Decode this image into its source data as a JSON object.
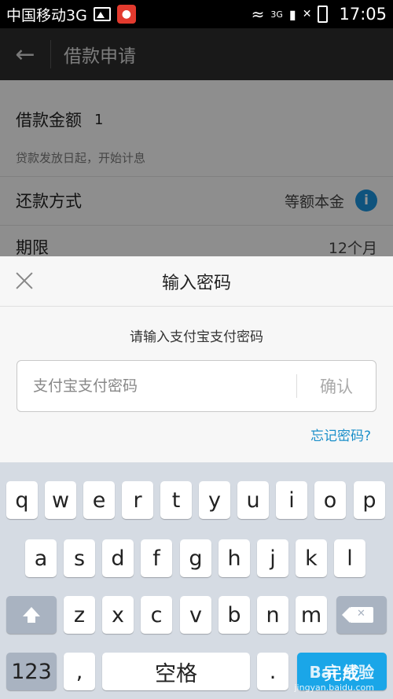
{
  "status_bar": {
    "carrier": "中国移动3G",
    "signal_label": "3G",
    "time": "17:05"
  },
  "header": {
    "title": "借款申请"
  },
  "form": {
    "amount_label": "借款金额",
    "amount_value": "1",
    "interest_note": "贷款发放日起，开始计息",
    "repay_label": "还款方式",
    "repay_value": "等额本金",
    "term_label": "期限",
    "term_value": "12个月"
  },
  "dialog": {
    "title": "输入密码",
    "prompt": "请输入支付宝支付密码",
    "input_placeholder": "支付宝支付密码",
    "confirm_label": "确认",
    "forgot_label": "忘记密码?"
  },
  "keyboard": {
    "row1": [
      "q",
      "w",
      "e",
      "r",
      "t",
      "y",
      "u",
      "i",
      "o",
      "p"
    ],
    "row2": [
      "a",
      "s",
      "d",
      "f",
      "g",
      "h",
      "j",
      "k",
      "l"
    ],
    "row3": [
      "z",
      "x",
      "c",
      "v",
      "b",
      "n",
      "m"
    ],
    "num_label": "123",
    "comma_label": ",",
    "space_label": "空格",
    "period_label": ".",
    "done_label": "完成"
  },
  "watermark": {
    "brand": "Bai 经验",
    "url": "jingyan.baidu.com"
  }
}
